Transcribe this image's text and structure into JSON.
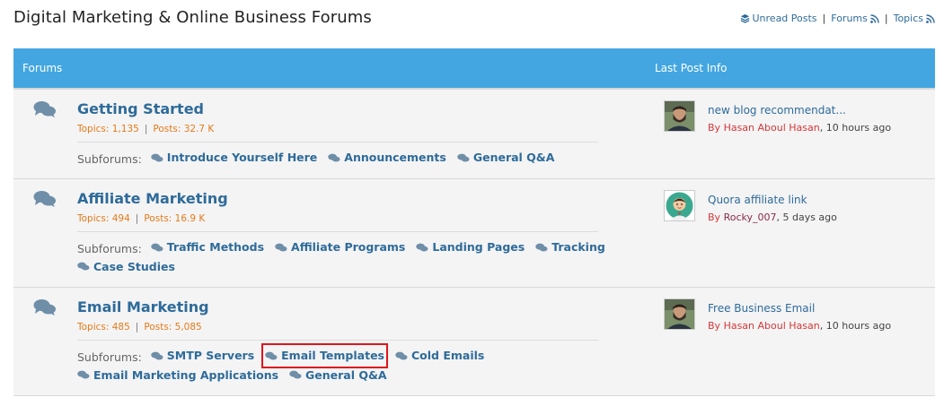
{
  "page": {
    "title": "Digital Marketing & Online Business Forums"
  },
  "toplinks": {
    "unread": "Unread Posts",
    "sep": "|",
    "forums": "Forums",
    "topics": "Topics"
  },
  "table": {
    "header_forums": "Forums",
    "header_last": "Last Post Info"
  },
  "forums": [
    {
      "title": "Getting Started",
      "topics": "Topics: 1,135",
      "posts": "Posts: 32.7 K",
      "subforums_label": "Subforums:",
      "subforums": [
        "Introduce Yourself Here",
        "Announcements",
        "General Q&A"
      ],
      "last_post": {
        "title": "new blog recommendat...",
        "by": "By",
        "user": "Hasan Aboul Hasan",
        "time": ", 10 hours ago"
      }
    },
    {
      "title": "Affiliate Marketing",
      "topics": "Topics: 494",
      "posts": "Posts: 16.9 K",
      "subforums_label": "Subforums:",
      "subforums": [
        "Traffic Methods",
        "Affiliate Programs",
        "Landing Pages",
        "Tracking",
        "Case Studies"
      ],
      "last_post": {
        "title": "Quora affiliate link",
        "by": "By",
        "user": "Rocky_007",
        "time": ", 5 days ago"
      }
    },
    {
      "title": "Email Marketing",
      "topics": "Topics: 485",
      "posts": "Posts: 5,085",
      "subforums_label": "Subforums:",
      "subforums": [
        "SMTP Servers",
        "Email Templates",
        "Cold Emails",
        "Email Marketing Applications",
        "General Q&A"
      ],
      "last_post": {
        "title": "Free Business Email",
        "by": "By",
        "user": "Hasan Aboul Hasan",
        "time": ", 10 hours ago"
      }
    }
  ],
  "colors": {
    "header": "#43a6e0",
    "link": "#2e6b9a",
    "stats": "#e47a1b",
    "highlight": "#e0141b"
  }
}
